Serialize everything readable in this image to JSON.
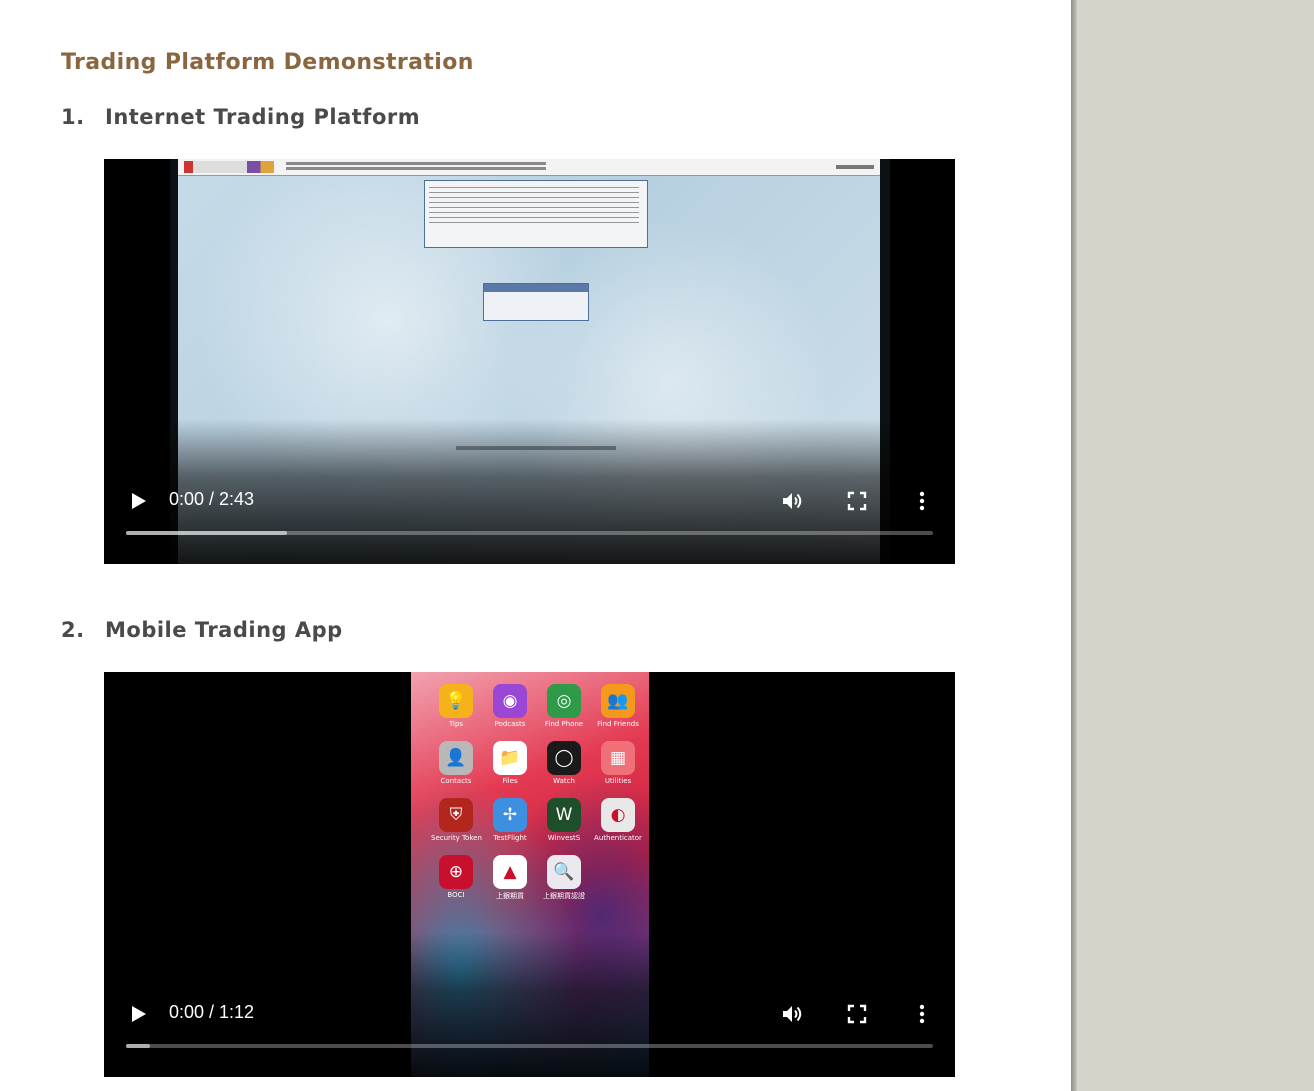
{
  "page": {
    "title": "Trading Platform Demonstration"
  },
  "sections": [
    {
      "number": "1.",
      "title": "Internet Trading Platform",
      "video": {
        "time": "0:00 / 2:43",
        "buffered": 0.2
      }
    },
    {
      "number": "2.",
      "title": "Mobile Trading App",
      "video": {
        "time": "0:00 / 1:12",
        "buffered": 0.03
      }
    }
  ],
  "phone_apps": [
    {
      "label": "Tips",
      "icon": "lightbulb-icon",
      "color": "#f6b21b",
      "glyph": "💡"
    },
    {
      "label": "Podcasts",
      "icon": "podcast-icon",
      "color": "#9b47d6",
      "glyph": "◉"
    },
    {
      "label": "Find Phone",
      "icon": "radar-icon",
      "color": "#2f9a47",
      "glyph": "◎"
    },
    {
      "label": "Find Friends",
      "icon": "friends-icon",
      "color": "#f39a1c",
      "glyph": "👥"
    },
    {
      "label": "Contacts",
      "icon": "contacts-icon",
      "color": "#b8b8b8",
      "glyph": "👤"
    },
    {
      "label": "Files",
      "icon": "folder-icon",
      "color": "#ffffff",
      "glyph": "📁"
    },
    {
      "label": "Watch",
      "icon": "watch-icon",
      "color": "#1a1a1a",
      "glyph": "◯"
    },
    {
      "label": "Utilities",
      "icon": "folder-grid-icon",
      "color": "#f07078",
      "glyph": "▦"
    },
    {
      "label": "Security Token",
      "icon": "shield-icon",
      "color": "#b3261e",
      "glyph": "⛨"
    },
    {
      "label": "TestFlight",
      "icon": "propeller-icon",
      "color": "#3d8fe0",
      "glyph": "✢"
    },
    {
      "label": "WinvestS",
      "icon": "chart-icon",
      "color": "#1e4e2a",
      "glyph": "W"
    },
    {
      "label": "Authenticator",
      "icon": "authenticator-icon",
      "color": "#e8e8e8",
      "glyph": "◐"
    },
    {
      "label": "BOCI",
      "icon": "boci-logo-icon",
      "color": "#c8102e",
      "glyph": "⊕"
    },
    {
      "label": "上銀期貨",
      "icon": "sbs-futures-icon",
      "color": "#ffffff",
      "glyph": "▲"
    },
    {
      "label": "上銀期貨認證",
      "icon": "sbs-auth-icon",
      "color": "#e9e9ef",
      "glyph": "🔍"
    }
  ],
  "colors": {
    "title": "#8a6640",
    "heading": "#4a4a4a",
    "sidebar": "#d6d3cb"
  }
}
